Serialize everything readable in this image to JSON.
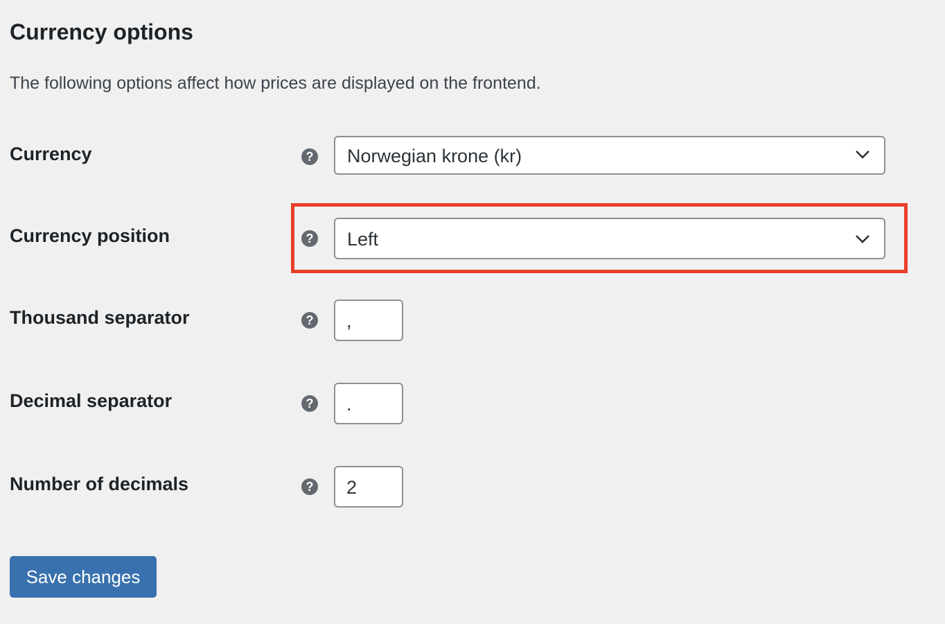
{
  "section": {
    "title": "Currency options",
    "description": "The following options affect how prices are displayed on the frontend."
  },
  "fields": [
    {
      "label": "Currency",
      "type": "select",
      "value": "Norwegian krone (kr)",
      "help_icon": "question-mark-icon"
    },
    {
      "label": "Currency position",
      "type": "select",
      "value": "Left",
      "help_icon": "question-mark-icon",
      "highlighted": true
    },
    {
      "label": "Thousand separator",
      "type": "text",
      "value": ",",
      "help_icon": "question-mark-icon"
    },
    {
      "label": "Decimal separator",
      "type": "text",
      "value": ".",
      "help_icon": "question-mark-icon"
    },
    {
      "label": "Number of decimals",
      "type": "number",
      "value": "2",
      "help_icon": "question-mark-icon"
    }
  ],
  "help_glyph": "?",
  "actions": {
    "save_label": "Save changes"
  },
  "colors": {
    "primary": "#3871ad",
    "highlight": "#e8412a",
    "background": "#f0f0f1"
  }
}
